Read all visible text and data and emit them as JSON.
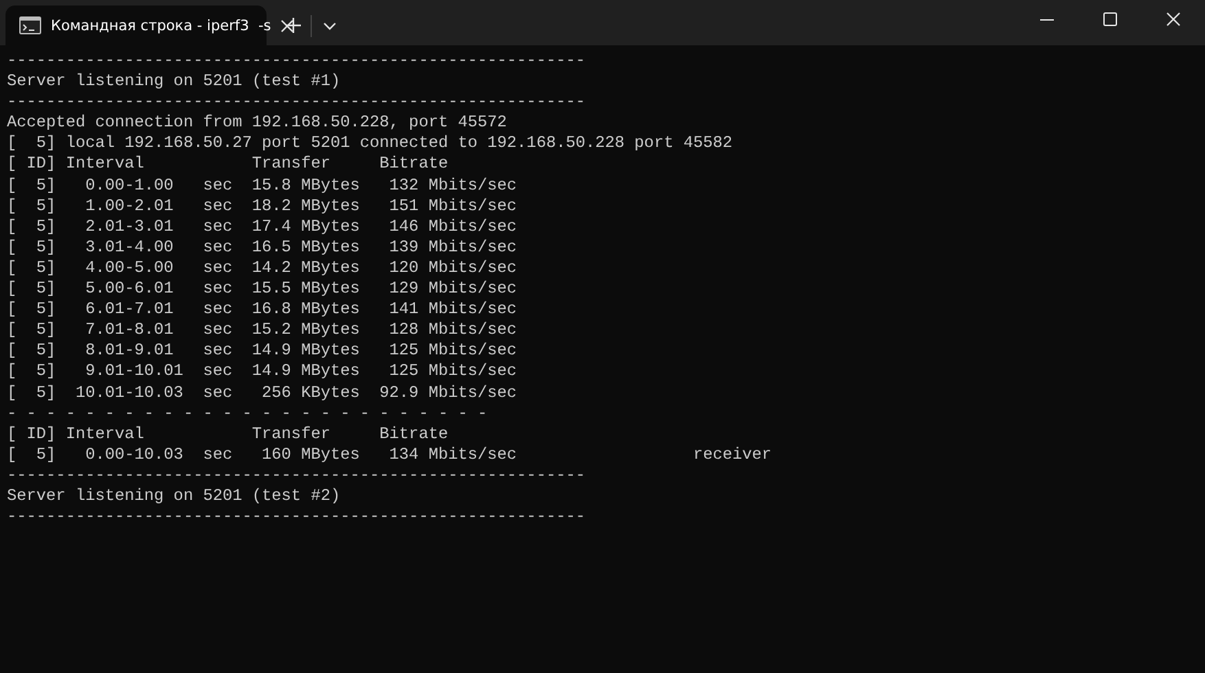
{
  "tabs": [
    {
      "title": "Командная строка - iperf3  -s",
      "selected": true
    }
  ],
  "lines": [
    "-----------------------------------------------------------",
    "Server listening on 5201 (test #1)",
    "-----------------------------------------------------------",
    "Accepted connection from 192.168.50.228, port 45572",
    "[  5] local 192.168.50.27 port 5201 connected to 192.168.50.228 port 45582",
    "[ ID] Interval           Transfer     Bitrate",
    "[  5]   0.00-1.00   sec  15.8 MBytes   132 Mbits/sec",
    "[  5]   1.00-2.01   sec  18.2 MBytes   151 Mbits/sec",
    "[  5]   2.01-3.01   sec  17.4 MBytes   146 Mbits/sec",
    "[  5]   3.01-4.00   sec  16.5 MBytes   139 Mbits/sec",
    "[  5]   4.00-5.00   sec  14.2 MBytes   120 Mbits/sec",
    "[  5]   5.00-6.01   sec  15.5 MBytes   129 Mbits/sec",
    "[  5]   6.01-7.01   sec  16.8 MBytes   141 Mbits/sec",
    "[  5]   7.01-8.01   sec  15.2 MBytes   128 Mbits/sec",
    "[  5]   8.01-9.01   sec  14.9 MBytes   125 Mbits/sec",
    "[  5]   9.01-10.01  sec  14.9 MBytes   125 Mbits/sec",
    "[  5]  10.01-10.03  sec   256 KBytes  92.9 Mbits/sec",
    "- - - - - - - - - - - - - - - - - - - - - - - - -",
    "[ ID] Interval           Transfer     Bitrate",
    "[  5]   0.00-10.03  sec   160 MBytes   134 Mbits/sec                  receiver",
    "-----------------------------------------------------------",
    "Server listening on 5201 (test #2)",
    "-----------------------------------------------------------"
  ]
}
